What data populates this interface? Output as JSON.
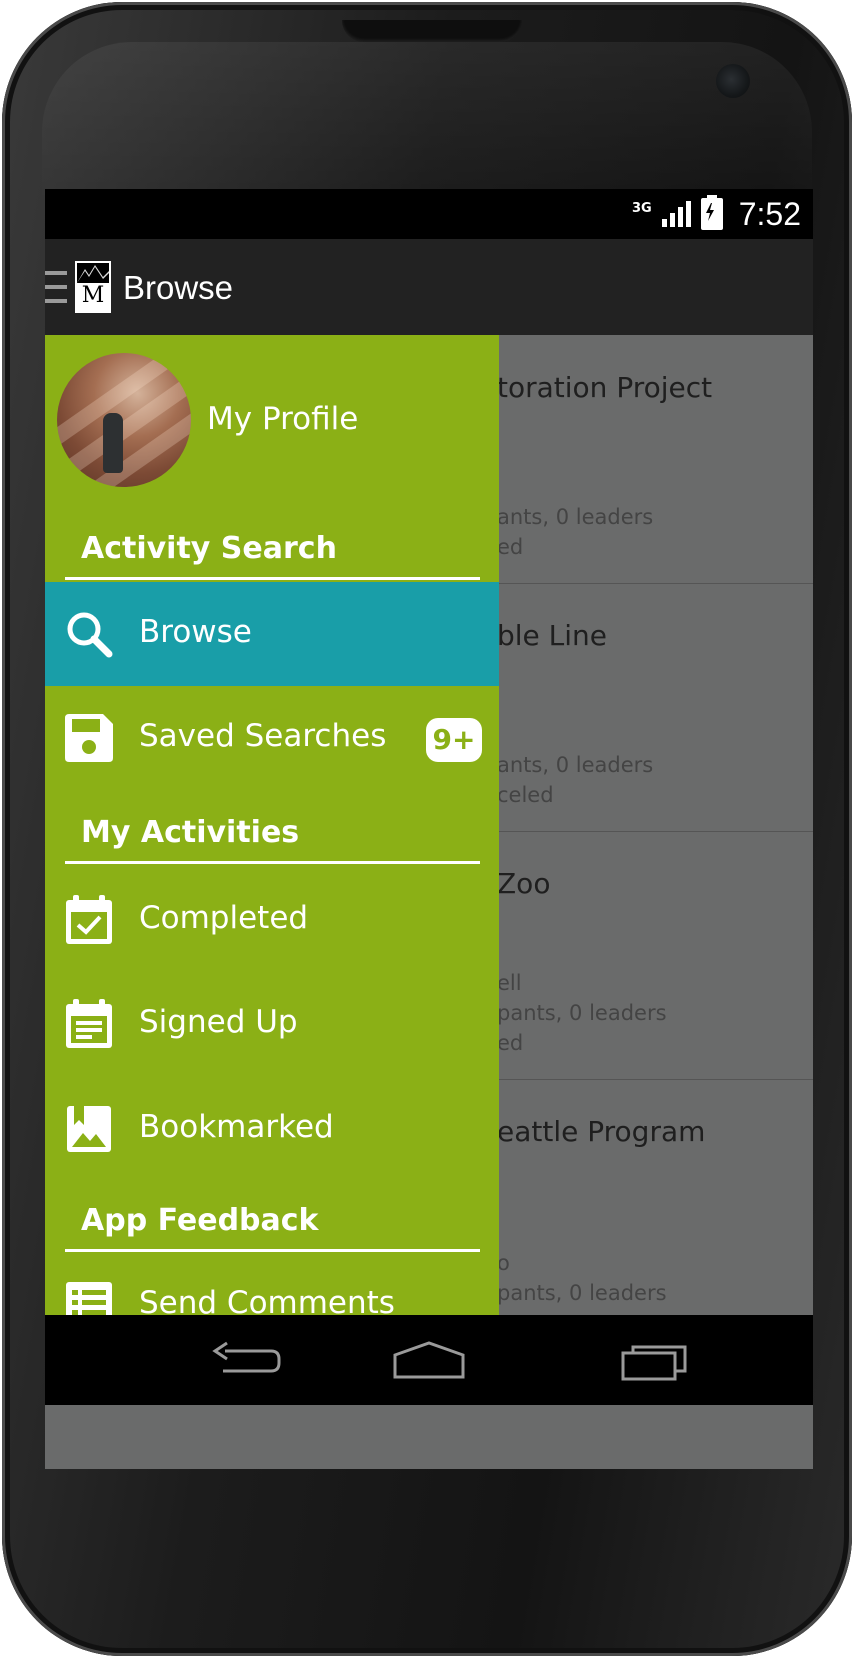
{
  "status_bar": {
    "network": "3G",
    "time": "7:52"
  },
  "action_bar": {
    "title": "Browse",
    "logo_letter": "M"
  },
  "background_list": [
    {
      "title": "toration Project",
      "lines": [
        "ants, 0 leaders",
        "ed"
      ]
    },
    {
      "title": "ble Line",
      "lines": [
        "ants, 0 leaders",
        "celed"
      ]
    },
    {
      "title": "Zoo",
      "lines": [
        "ell",
        "pants, 0 leaders",
        "ed"
      ]
    },
    {
      "title": "eattle Program",
      "lines": [
        "o",
        "pants, 0 leaders"
      ]
    }
  ],
  "drawer": {
    "profile_label": "My Profile",
    "sections": {
      "activity_search": "Activity Search",
      "my_activities": "My Activities",
      "app_feedback": "App Feedback"
    },
    "items": {
      "browse": "Browse",
      "saved_searches": "Saved Searches",
      "saved_badge": "9+",
      "completed": "Completed",
      "signed_up": "Signed Up",
      "bookmarked": "Bookmarked",
      "send_comments": "Send Comments"
    }
  },
  "colors": {
    "drawer_green": "#8bb016",
    "active_teal": "#199ea8",
    "action_bar": "#222222"
  },
  "icons": [
    "menu-icon",
    "search-icon",
    "save-disk-icon",
    "calendar-check-icon",
    "calendar-list-icon",
    "bookmark-image-icon",
    "list-icon",
    "back-icon",
    "home-icon",
    "recents-icon"
  ]
}
